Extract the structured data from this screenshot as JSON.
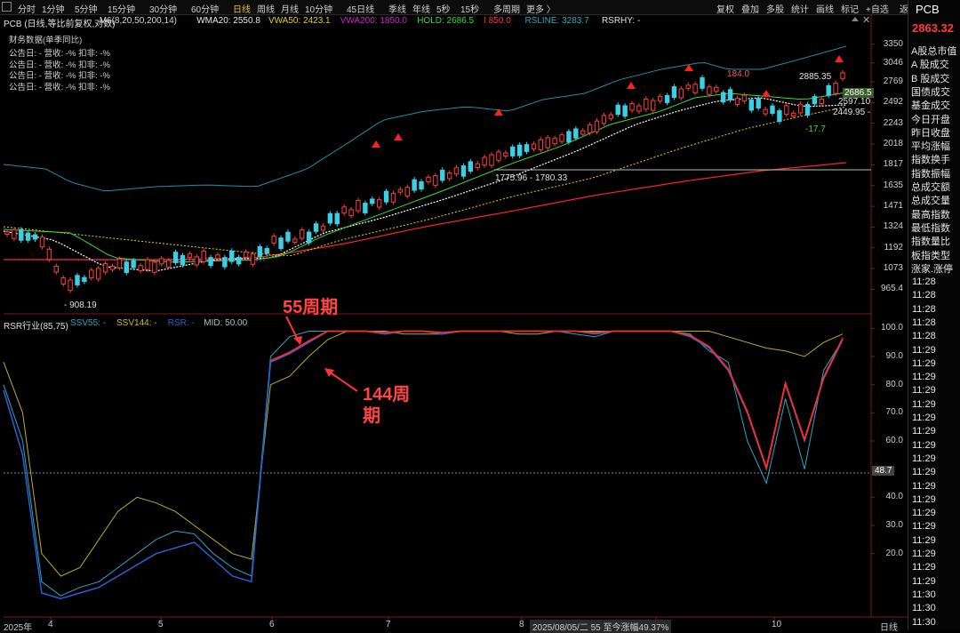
{
  "toolbar": {
    "timeframes": [
      "分时",
      "1分钟",
      "5分钟",
      "15分钟",
      "30分钟",
      "60分钟",
      "日线",
      "周线",
      "月线",
      "10分钟",
      "45日线",
      "季线",
      "年线",
      "5秒",
      "15秒",
      "多周期",
      "更多 〉"
    ],
    "active_timeframe": "日线",
    "right_buttons": [
      "复权",
      "叠加",
      "多股",
      "统计",
      "画线",
      "标记",
      "+自选",
      "返回"
    ]
  },
  "main_legend": {
    "title": "PCB (日线,等比前复权,对数)",
    "items": [
      {
        "text": "M6(8,20,50,200,14)",
        "color": "#d8d8d8"
      },
      {
        "text": "WMA20: 2550.8",
        "color": "#e8e8e8"
      },
      {
        "text": "VWA50: 2423.1",
        "color": "#e6d400"
      },
      {
        "text": "VWA200: 1850.0",
        "color": "#cc22cc"
      },
      {
        "text": "HOLD: 2686.5",
        "color": "#33dd33"
      },
      {
        "text": "I 850.0",
        "color": "#ff3333"
      },
      {
        "text": "RSLINE: 3283.7",
        "color": "#2aa6c4"
      },
      {
        "text": "RSRHY: -",
        "color": "#e0e0e0"
      }
    ]
  },
  "financial": {
    "title": "财务数据(单季同比)",
    "rows": [
      "公告日: -  营收: -%  扣非: -%",
      "公告日: -  营收: -%  扣非: -%",
      "公告日: -  营收: -%  扣非: -%",
      "公告日: -  营收: -%  扣非: -%"
    ]
  },
  "right_panel": {
    "code": "PCB",
    "price": "2863.32",
    "items": [
      "A股总市值",
      "A 股成交",
      "B 股成交",
      "国债成交",
      "基金成交",
      "今日开盘",
      "昨日收盘",
      "平均涨幅",
      "指数换手",
      "指数振幅",
      "总成交额",
      "总成交量",
      "最高指数",
      "最低指数",
      "指数量比",
      "板指类型",
      "涨家.涨停"
    ],
    "times": [
      "11:28",
      "11:28",
      "11:28",
      "11:28",
      "11:28",
      "11:29",
      "11:29",
      "11:29",
      "11:29",
      "11:29",
      "11:29",
      "11:29",
      "11:29",
      "11:29",
      "11:29",
      "11:29",
      "11:29",
      "11:29",
      "11:29",
      "11:29",
      "11:29",
      "11:29",
      "11:29",
      "11:30",
      "11:30",
      "11:30"
    ]
  },
  "sub_legend": {
    "items": [
      {
        "text": "RSR行业(85,75)",
        "color": "#e0e0e0"
      },
      {
        "text": "SSV55: -",
        "color": "#2aa6c4"
      },
      {
        "text": "SSV144: -",
        "color": "#c8c020"
      },
      {
        "text": "RSR: -",
        "color": "#2a5fd8"
      },
      {
        "text": "MID: 50.00",
        "color": "#bbbbbb"
      }
    ]
  },
  "annotations": {
    "label_55": "55周期",
    "label_144": "144周期"
  },
  "price_labels": {
    "high_2885": "2885.35",
    "hold_2686": "2686.5",
    "p2597": "2597.10",
    "p2449": "2449.95 -",
    "low_908": "- 908.19",
    "p184": "184.0",
    "neg177": "-17.7",
    "range_mid": "1775.96 - 1780.33",
    "rsr_value": "48.7"
  },
  "bottom_bar": {
    "year": "2025年",
    "range_text": "2025/08/05/二 55 至今涨幅49.37%",
    "period": "日线"
  },
  "colors": {
    "up": "#ff3b3b",
    "down": "#39d0e6",
    "wma20": "#ffffff",
    "vwa50": "#e6d400",
    "vwa200": "#cc22cc",
    "hold": "#33dd33",
    "ma200": "#ff2222",
    "rsline": "#1e8fa8",
    "ssv55": "#2aa6c4",
    "ssv144": "#b8b01c",
    "rsr_red": "#ff2a2a",
    "rsr_blue": "#2a5fd8"
  },
  "chart_data": [
    {
      "type": "candlestick",
      "title": "PCB (日线,等比前复权,对数)",
      "y_scale": "log",
      "y_ticks": [
        3350,
        3046,
        2769,
        2492,
        2243,
        2018,
        1817,
        1635,
        1471,
        1324,
        1192,
        1073,
        965.4
      ],
      "x_ticks": [
        "4",
        "5",
        "6",
        "7",
        "8",
        "9",
        "10"
      ],
      "ylim": [
        880,
        3500
      ],
      "close_approx": [
        1290,
        1270,
        1260,
        1230,
        1200,
        1210,
        920,
        960,
        1040,
        1080,
        1160,
        1180,
        1220,
        1260,
        1300,
        1310,
        1350,
        1400,
        1430,
        1460,
        1500,
        1560,
        1620,
        1690,
        1750,
        1780,
        1820,
        1880,
        1950,
        2020,
        2080,
        2130,
        2180,
        2230,
        2290,
        2360,
        2440,
        2520,
        2600,
        2680,
        2720,
        2760,
        2700,
        2640,
        2580,
        2520,
        2480,
        2450,
        2600,
        2863.32
      ]
    },
    {
      "type": "line",
      "title": "RSR行业(85,75)",
      "y_ticks": [
        100,
        90,
        80,
        70,
        60,
        48.7,
        40,
        30,
        20
      ],
      "ylim": [
        0,
        102
      ],
      "x_ticks": [
        "2025年",
        "4",
        "5",
        "6",
        "7",
        "8",
        "9",
        "10"
      ],
      "series": [
        {
          "name": "SSV55",
          "values": [
            80,
            60,
            10,
            5,
            8,
            10,
            15,
            20,
            25,
            28,
            27,
            20,
            15,
            12,
            90,
            97,
            99,
            99,
            99,
            99,
            98,
            99,
            99,
            98,
            99,
            99,
            99,
            99,
            99,
            99,
            98,
            97,
            99,
            99,
            99,
            99,
            98,
            92,
            88,
            60,
            45,
            75,
            50,
            85,
            96
          ]
        },
        {
          "name": "SSV144",
          "values": [
            88,
            70,
            20,
            12,
            15,
            25,
            35,
            40,
            38,
            35,
            30,
            25,
            20,
            18,
            80,
            83,
            90,
            96,
            99,
            99,
            99,
            98,
            98,
            98,
            99,
            99,
            99,
            98,
            98,
            99,
            99,
            99,
            99,
            99,
            99,
            99,
            99,
            99,
            97,
            95,
            93,
            92,
            90,
            95,
            98
          ]
        },
        {
          "name": "RSR",
          "values": [
            78,
            55,
            6,
            4,
            6,
            8,
            12,
            16,
            20,
            22,
            24,
            18,
            12,
            10,
            88,
            91,
            95,
            99,
            99,
            99,
            98,
            99,
            99,
            98,
            99,
            99,
            99,
            99,
            99,
            99,
            99,
            98,
            99,
            99,
            99,
            99,
            97,
            93,
            85,
            70,
            50,
            80,
            60,
            82,
            96
          ]
        }
      ],
      "mid": 50.0
    }
  ]
}
